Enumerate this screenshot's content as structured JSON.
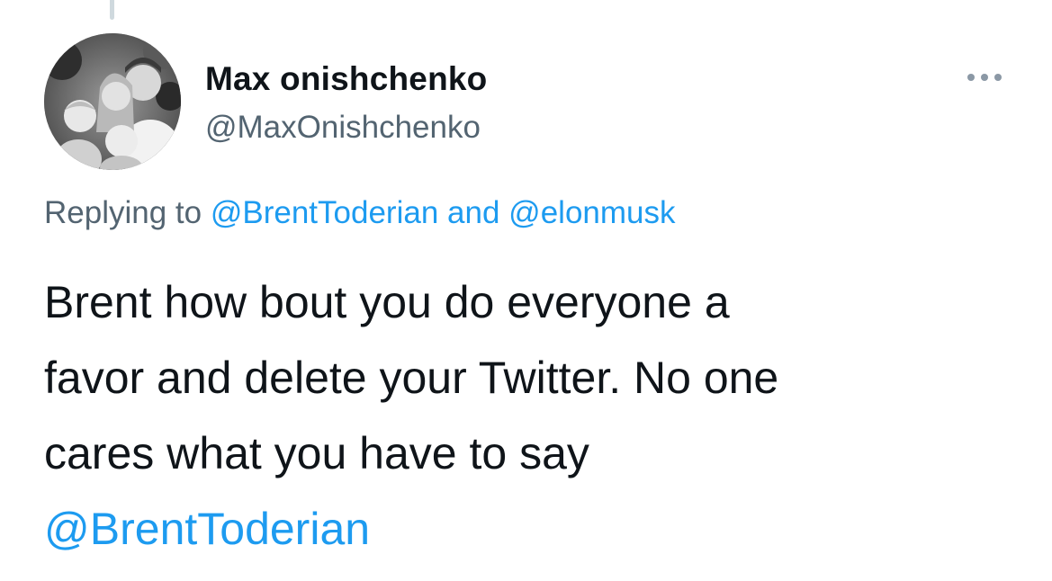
{
  "author": {
    "display_name": "Max onishchenko",
    "handle": "@MaxOnishchenko"
  },
  "menu": {
    "icon": "more-horizontal-icon"
  },
  "reply_context": {
    "prefix": "Replying to",
    "mention_1": "@BrentToderian",
    "conjunction": "and",
    "mention_2": "@elonmusk"
  },
  "tweet": {
    "lines": [
      "Brent how bout you do everyone a",
      "favor and delete your Twitter. No one",
      "cares what you have to say"
    ],
    "mention": "@BrentToderian"
  },
  "colors": {
    "link": "#1d9bf0",
    "secondary_text": "#536471",
    "primary_text": "#0f1419",
    "thread_line": "#cfd9de"
  }
}
